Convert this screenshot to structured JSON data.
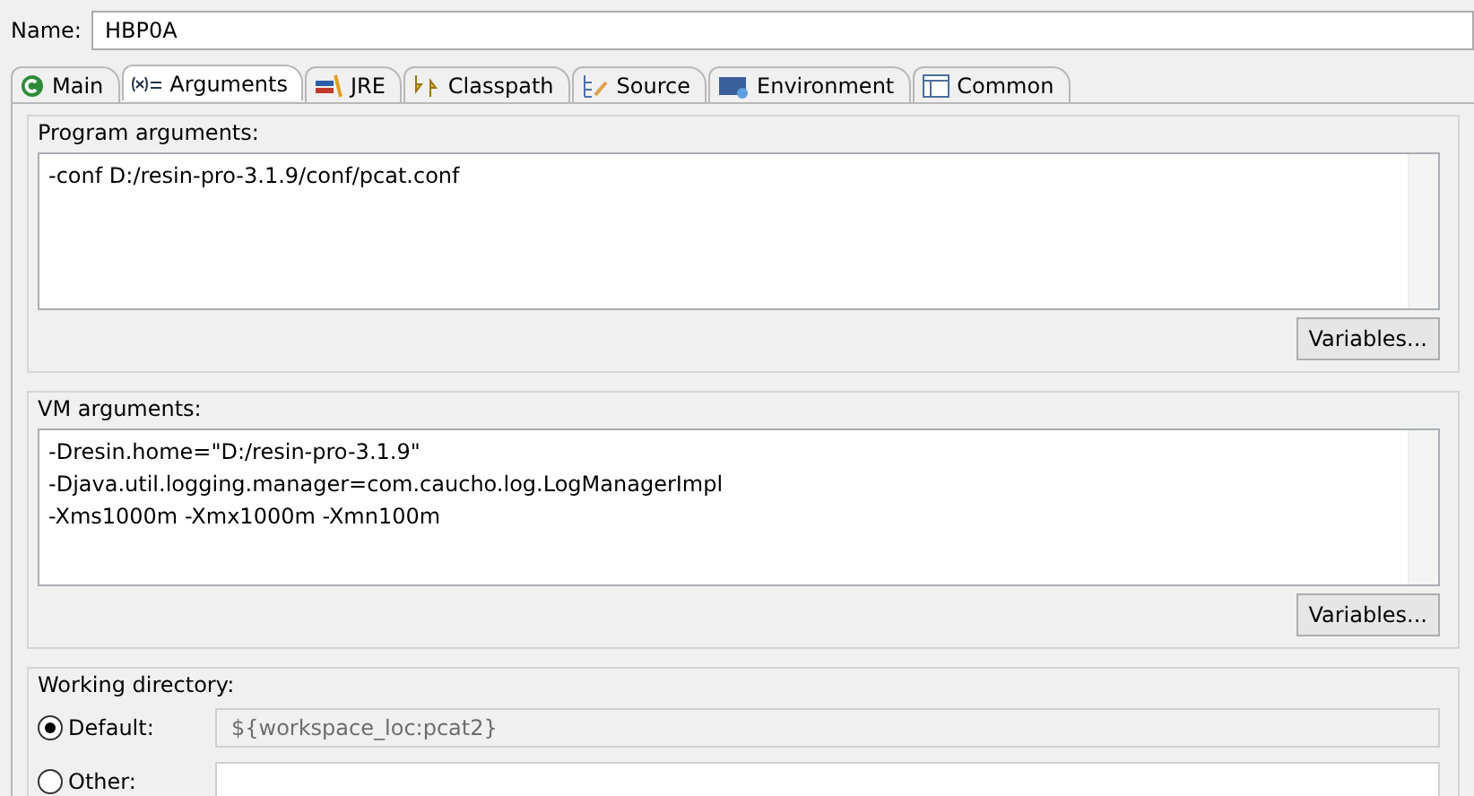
{
  "name_field": {
    "label": "Name:",
    "value": "HBP0A"
  },
  "tabs": [
    {
      "label": "Main",
      "kind": "main",
      "selected": false
    },
    {
      "label": "Arguments",
      "kind": "args",
      "selected": true
    },
    {
      "label": "JRE",
      "kind": "jre",
      "selected": false
    },
    {
      "label": "Classpath",
      "kind": "classpath",
      "selected": false
    },
    {
      "label": "Source",
      "kind": "source",
      "selected": false
    },
    {
      "label": "Environment",
      "kind": "env",
      "selected": false
    },
    {
      "label": "Common",
      "kind": "common",
      "selected": false
    }
  ],
  "args_groups": [
    {
      "title": "Program arguments:",
      "lines": [
        "-conf D:/resin-pro-3.1.9/conf/pcat.conf"
      ],
      "button": "Variables..."
    },
    {
      "title": "VM arguments:",
      "lines": [
        "-Dresin.home=\"D:/resin-pro-3.1.9\"",
        "-Djava.util.logging.manager=com.caucho.log.LogManagerImpl",
        "-Xms1000m -Xmx1000m -Xmn100m"
      ],
      "button": "Variables..."
    }
  ],
  "working_directory": {
    "title": "Working directory:",
    "options": [
      {
        "label": "Default:",
        "selected": true,
        "value": "${workspace_loc:pcat2}",
        "disabled": true
      },
      {
        "label": "Other:",
        "selected": false,
        "disabled": false
      }
    ]
  }
}
